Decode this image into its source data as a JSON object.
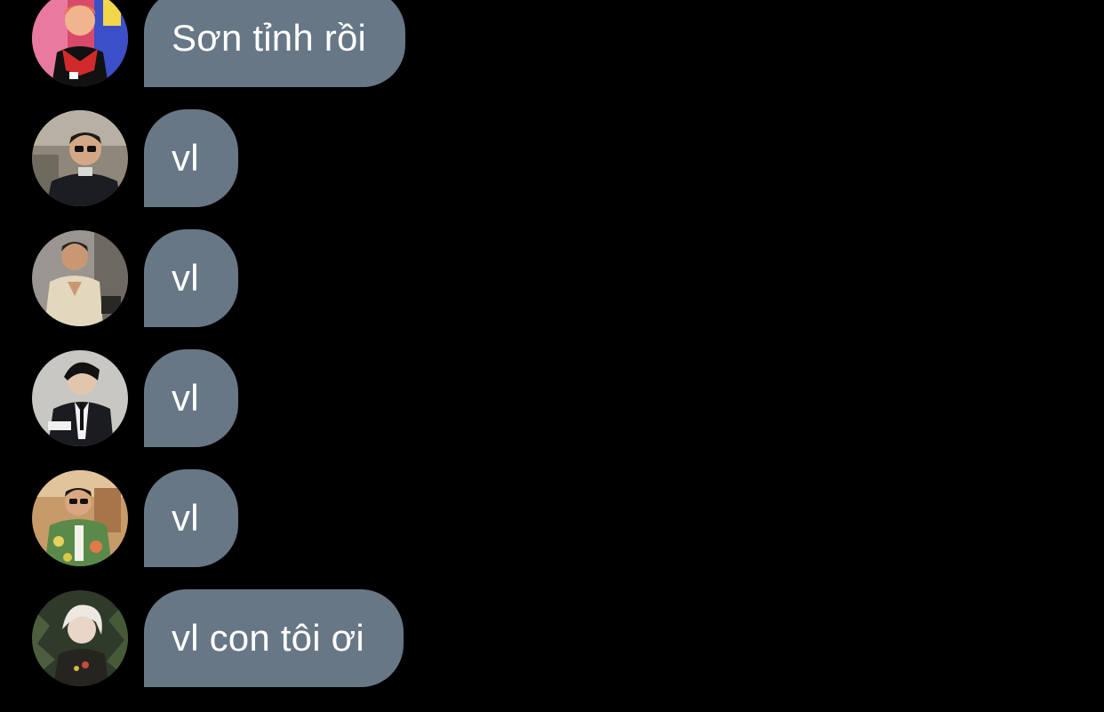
{
  "colors": {
    "background": "#000000",
    "bubble": "#677786",
    "text": "#ffffff"
  },
  "messages": [
    {
      "avatar_icon": "avatar-red-hair-person",
      "text": "Sơn tỉnh rồi"
    },
    {
      "avatar_icon": "avatar-sunglasses-man-dark-coat",
      "text": "vl"
    },
    {
      "avatar_icon": "avatar-man-cream-shirt",
      "text": "vl"
    },
    {
      "avatar_icon": "avatar-man-dark-suit",
      "text": "vl"
    },
    {
      "avatar_icon": "avatar-man-floral-shirt-sunglasses",
      "text": "vl"
    },
    {
      "avatar_icon": "avatar-blonde-person-foliage",
      "text": "vl con tôi ơi"
    }
  ]
}
